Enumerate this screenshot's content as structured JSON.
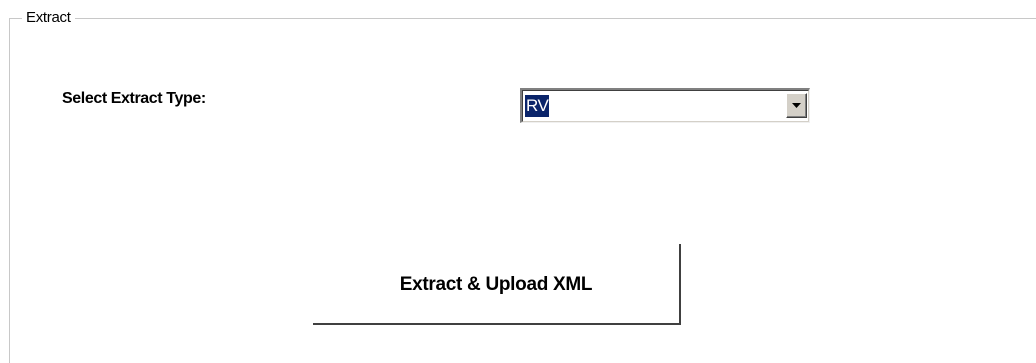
{
  "extract_group": {
    "legend": "Extract"
  },
  "extract_type": {
    "label": "Select Extract Type:",
    "selected_value": "RV"
  },
  "actions": {
    "extract_upload_label": "Extract & Upload XML"
  },
  "colors": {
    "selection_highlight": "#0a246a",
    "button_face": "#d4d0c8",
    "group_border": "#c8c8c8"
  },
  "icons": {
    "dropdown": "chevron-down-icon"
  }
}
